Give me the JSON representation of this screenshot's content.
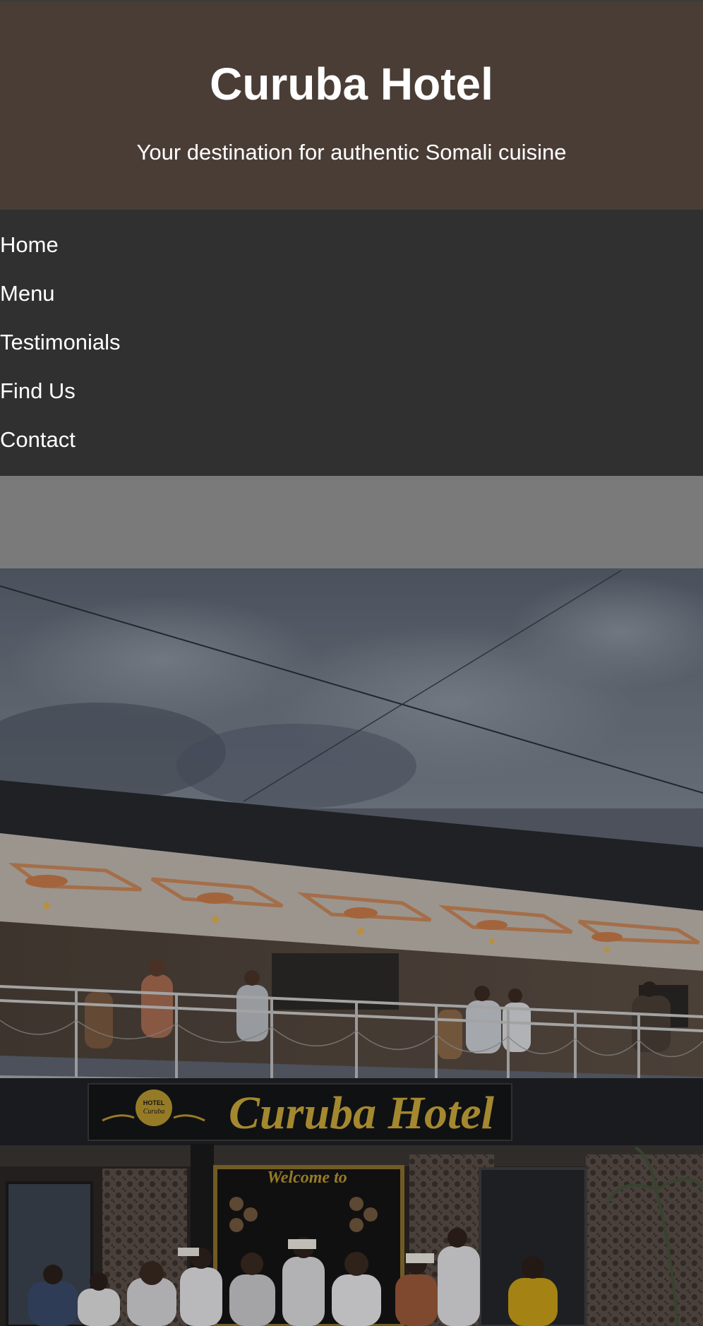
{
  "header": {
    "title": "Curuba Hotel",
    "tagline": "Your destination for authentic Somali cuisine"
  },
  "nav": {
    "items": [
      {
        "label": "Home"
      },
      {
        "label": "Menu"
      },
      {
        "label": "Testimonials"
      },
      {
        "label": "Find Us"
      },
      {
        "label": "Contact"
      }
    ]
  },
  "hero": {
    "sign_text": "Curuba Hotel",
    "logo_text_top": "HOTEL",
    "logo_text_bottom": "Curuba",
    "welcome_text": "Welcome to"
  },
  "colors": {
    "header_bg": "#4a3d36",
    "nav_bg": "#303030",
    "gap_bg": "#7a7a7a",
    "sign_gold": "#c9a63a"
  }
}
